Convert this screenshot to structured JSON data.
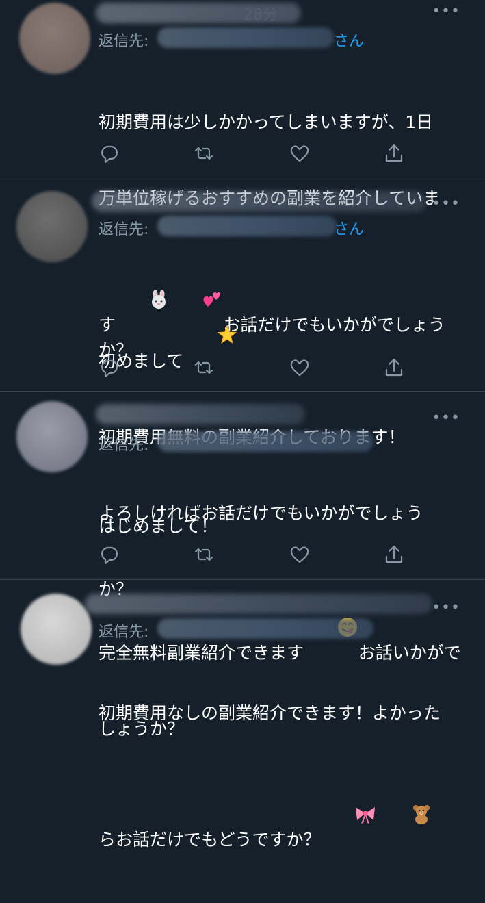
{
  "tweets": [
    {
      "reply_label": "返信先:",
      "reply_suffix": "さん",
      "timestamp_partial": "28分",
      "lines": [
        "初期費用は少しかかってしまいますが、1日",
        "万単位稼げるおすすめの副業を紹介していま",
        "す"
      ],
      "line3_after": "お話だけでもいかがでしょうか？",
      "emojis": [
        "rabbit-face-emoji",
        "two-hearts-emoji"
      ]
    },
    {
      "reply_label": "返信先:",
      "reply_suffix": "さん",
      "line1": "初めまして",
      "emoji1": "glowing-star-emoji",
      "lines": [
        "初期費用無料の副業紹介しております！",
        "よろしければお話だけでもいかがでしょう",
        "か？"
      ]
    },
    {
      "reply_label": "返信先:",
      "line1": "はじめまして！",
      "line2_before": "完全無料副業紹介できます",
      "line2_after": "お話いかがで",
      "line3": "しょうか？",
      "emoji": "savoring-food-face-emoji"
    },
    {
      "reply_label": "返信先:",
      "line1": "初期費用なしの副業紹介できます！よかった",
      "line2": "らお話だけでもどうですか？",
      "emojis": [
        "ribbon-emoji",
        "teddy-bear-emoji"
      ]
    }
  ],
  "colors": {
    "background": "#15202b",
    "muted": "#8899a6",
    "accent": "#1d9bf0",
    "divider": "#38444d"
  },
  "icons": [
    "reply-icon",
    "retweet-icon",
    "like-icon",
    "share-icon",
    "more-icon"
  ]
}
